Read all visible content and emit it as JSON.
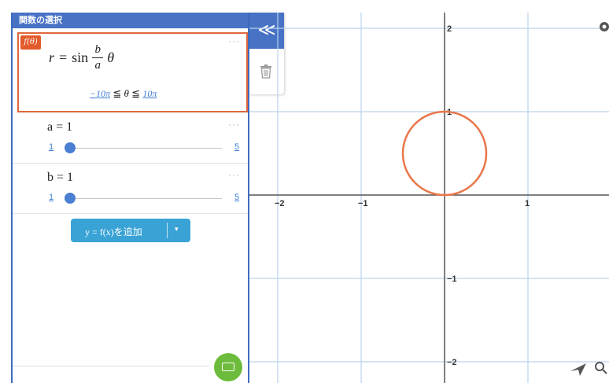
{
  "panel": {
    "title": "関数の選択"
  },
  "function": {
    "badge": "f(θ)",
    "lhs": "r",
    "func": "sin",
    "numerator": "b",
    "denominator": "a",
    "variable": "θ",
    "range_min": "−10π",
    "range_max": "10π",
    "range_var": "θ",
    "le": "≦",
    "more": "···"
  },
  "params": [
    {
      "name": "a = 1",
      "min": "1",
      "max": "5",
      "value": 1,
      "more": "···"
    },
    {
      "name": "b = 1",
      "min": "1",
      "max": "5",
      "value": 1,
      "more": "···"
    }
  ],
  "add_button": {
    "label": "y = f(x)を追加",
    "caret": "▾"
  },
  "toolbar": {
    "collapse": "≪"
  },
  "graph": {
    "x_ticks": [
      "−2",
      "−1",
      "1"
    ],
    "y_ticks": [
      "2",
      "1",
      "−1",
      "−2"
    ],
    "curve_color": "#e8764a",
    "grid_color": "#b9d3ee"
  },
  "chart_data": {
    "type": "line",
    "equation": "r = sin(b/a θ)",
    "series": [
      {
        "shape": "circle",
        "center": [
          0,
          0.5
        ],
        "radius": 0.5
      }
    ],
    "xlim": [
      -2,
      2
    ],
    "ylim": [
      -2,
      2
    ],
    "grid": true
  }
}
